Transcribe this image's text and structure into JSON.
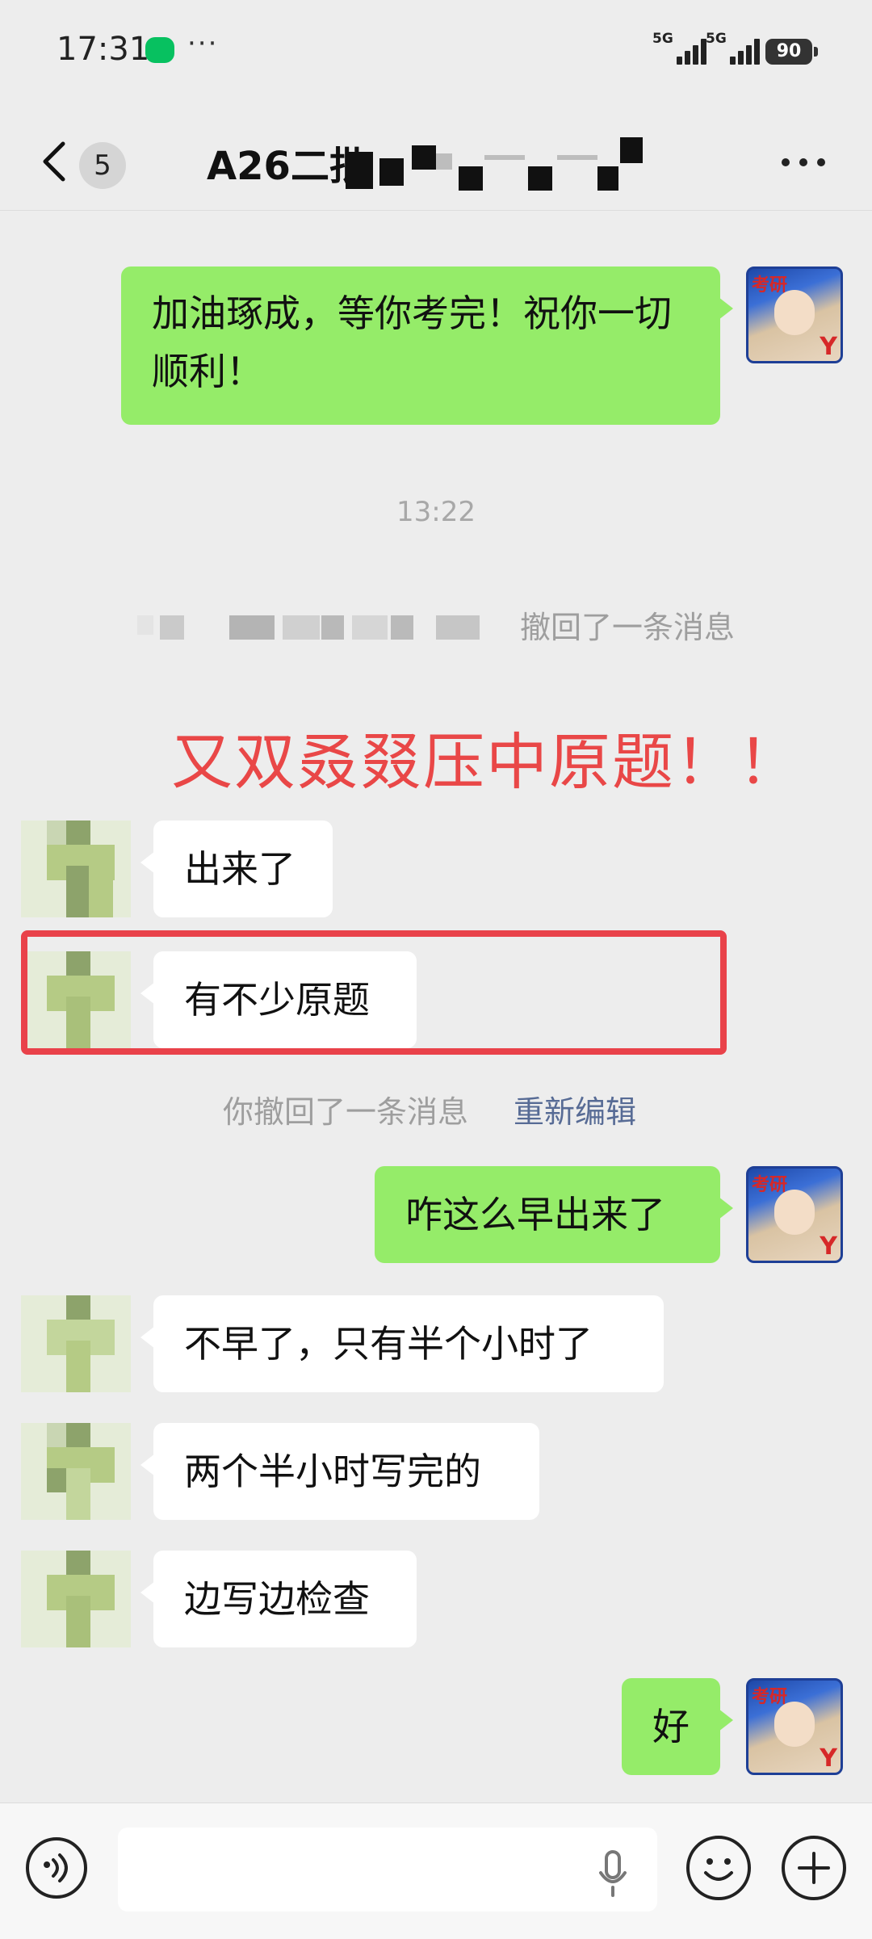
{
  "status_bar": {
    "time": "17:31",
    "more_dots": "···",
    "signal_1_label": "5G",
    "signal_2_label": "5G",
    "battery": "90"
  },
  "header": {
    "back_icon": "chevron-left-icon",
    "unread_count": "5",
    "title_prefix": "A26二批",
    "more_icon": "ellipsis-icon"
  },
  "messages": {
    "m1": "加油琢成，等你考完！祝你一切顺利！",
    "time_1": "13:22",
    "recall_other": "撤回了一条消息",
    "annotation": "又双叒叕压中原题！！",
    "m2": "出来了",
    "m3": "有不少原题",
    "recall_self": "你撤回了一条消息",
    "reedit": "重新编辑",
    "m4": "咋这么早出来了",
    "m5": "不早了，只有半个小时了",
    "m6": "两个半小时写完的",
    "m7": "边写边检查",
    "m8": "好",
    "my_avatar_tag": "考研",
    "my_avatar_mark": "Y"
  },
  "input_bar": {
    "voice_icon": "voice-icon",
    "mic_icon": "microphone-icon",
    "emoji_icon": "emoji-icon",
    "plus_icon": "plus-icon"
  },
  "colors": {
    "bubble_me": "#95ec69",
    "bubble_other": "#ffffff",
    "background": "#ededed",
    "annotation_red": "#e94747",
    "link_blue": "#576b95"
  }
}
